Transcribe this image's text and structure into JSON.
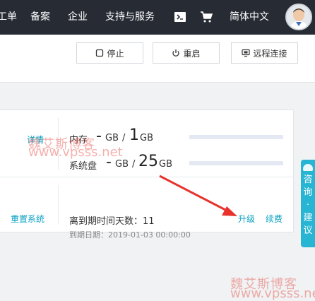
{
  "nav": {
    "items": [
      "工单",
      "备案",
      "企业",
      "支持与服务"
    ],
    "terminal_icon": "terminal-icon",
    "cart_icon": "cart-icon",
    "language": "简体中文",
    "avatar_icon": "user-avatar"
  },
  "toolbar": {
    "stop_label": "停止",
    "restart_label": "重启",
    "remote_label": "远程连接"
  },
  "resources": {
    "details_link": "详情",
    "memory": {
      "label": "内存",
      "used": "-",
      "used_unit": "GB",
      "separator": "/",
      "total": "1",
      "total_unit": "GB",
      "usage_fraction": 0
    },
    "disk": {
      "label": "系统盘",
      "used": "-",
      "used_unit": "GB",
      "separator": "/",
      "total": "25",
      "total_unit": "GB",
      "usage_fraction": 0
    }
  },
  "expiry": {
    "reinstall_link": "重置系统",
    "days_text": "离到期时间天数：11",
    "date_text": "到期日期：2019-01-03 00:00:00",
    "upgrade_link": "升级",
    "renew_link": "续费"
  },
  "watermarks": {
    "name": "魏艾斯博客",
    "site": "www.vpsss.net"
  },
  "consult": {
    "label": "咨询·建议"
  },
  "colors": {
    "accent": "#0aa1c2",
    "nav_bg": "#262b34",
    "arrow": "#e8322c",
    "watermark": "#e65046"
  }
}
